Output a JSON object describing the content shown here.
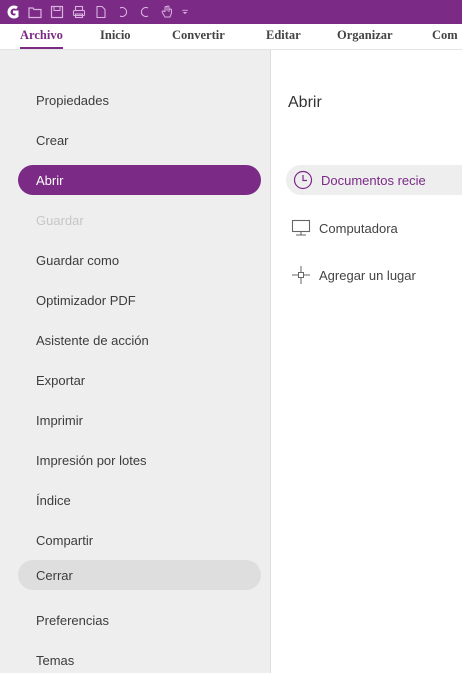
{
  "menubar": {
    "tabs": [
      {
        "label": "Archivo",
        "active": true
      },
      {
        "label": "Inicio"
      },
      {
        "label": "Convertir"
      },
      {
        "label": "Editar"
      },
      {
        "label": "Organizar"
      },
      {
        "label": "Com"
      }
    ]
  },
  "sidebar": {
    "items": [
      {
        "label": "Propiedades"
      },
      {
        "label": "Crear"
      },
      {
        "label": "Abrir",
        "state": "active"
      },
      {
        "label": "Guardar",
        "state": "disabled"
      },
      {
        "label": "Guardar como"
      },
      {
        "label": "Optimizador PDF"
      },
      {
        "label": "Asistente de acción"
      },
      {
        "label": "Exportar"
      },
      {
        "label": "Imprimir"
      },
      {
        "label": "Impresión por lotes"
      },
      {
        "label": "Índice"
      },
      {
        "label": "Compartir"
      },
      {
        "label": "Cerrar",
        "state": "hover"
      },
      {
        "label": "Preferencias"
      },
      {
        "label": "Temas"
      }
    ]
  },
  "content": {
    "title": "Abrir",
    "options": [
      {
        "label": "Documentos recie",
        "icon": "clock-icon",
        "selected": true
      },
      {
        "label": "Computadora",
        "icon": "monitor-icon"
      },
      {
        "label": "Agregar un lugar",
        "icon": "plus-icon"
      }
    ]
  },
  "colors": {
    "accent": "#7b2a86",
    "sidebar_bg": "#eeeeee",
    "disabled_text": "#c6c6c6"
  }
}
